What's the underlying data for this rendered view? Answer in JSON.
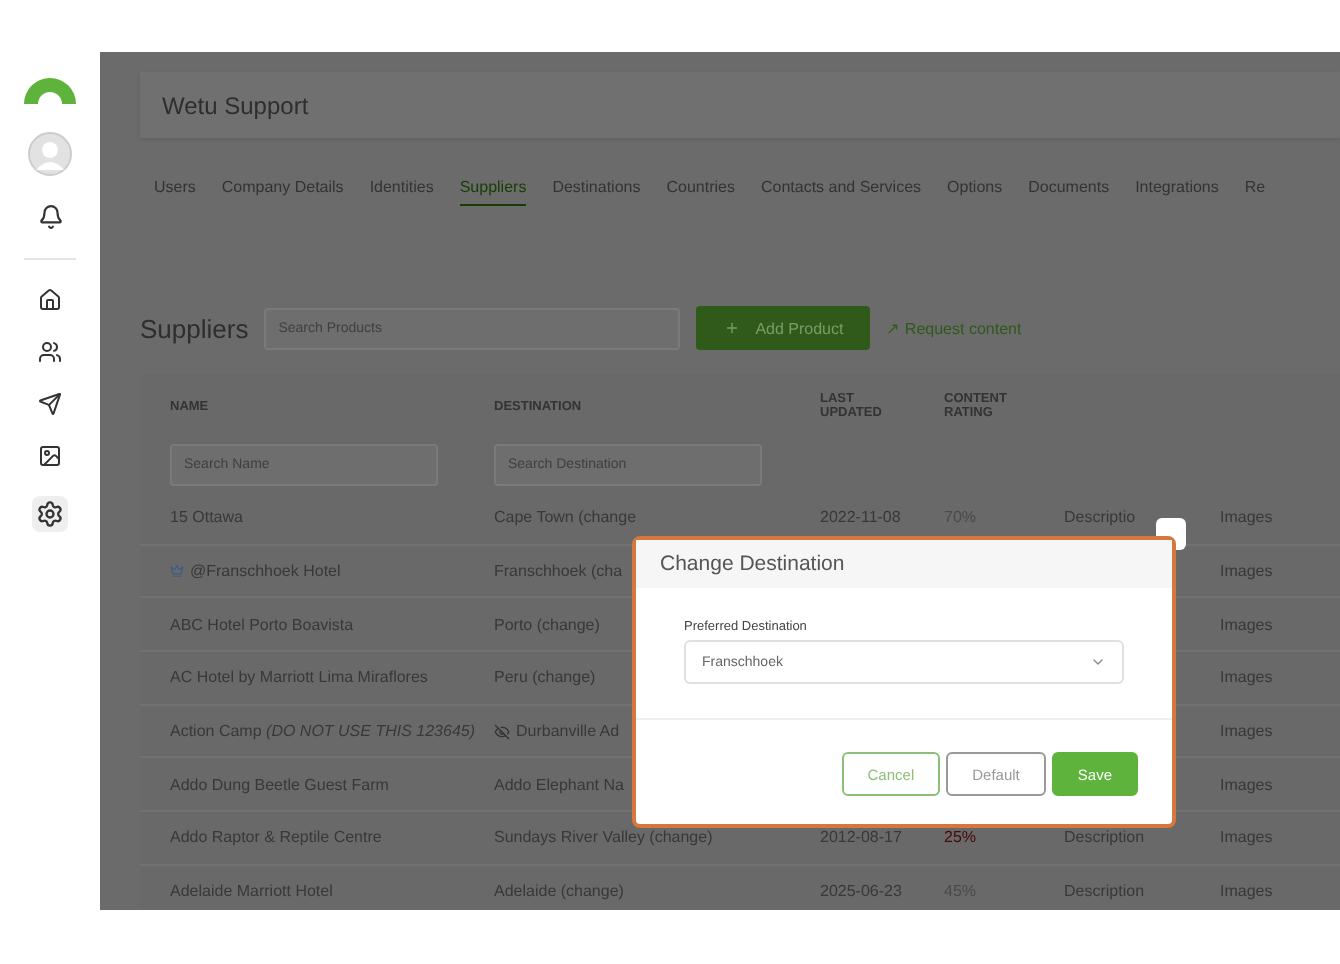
{
  "header": {
    "title": "Wetu Support"
  },
  "tabs": [
    {
      "label": "Users",
      "selected": false
    },
    {
      "label": "Company Details",
      "selected": false
    },
    {
      "label": "Identities",
      "selected": false
    },
    {
      "label": "Suppliers",
      "selected": true
    },
    {
      "label": "Destinations",
      "selected": false
    },
    {
      "label": "Countries",
      "selected": false
    },
    {
      "label": "Contacts and Services",
      "selected": false
    },
    {
      "label": "Options",
      "selected": false
    },
    {
      "label": "Documents",
      "selected": false
    },
    {
      "label": "Integrations",
      "selected": false
    },
    {
      "label": "Re",
      "selected": false
    }
  ],
  "toolbar": {
    "title": "Suppliers",
    "search_placeholder": "Search Products",
    "add_button": "Add Product",
    "link": "↗ Request content"
  },
  "table": {
    "columns": [
      "NAME",
      "DESTINATION",
      "LAST UPDATED",
      "CONTENT RATING"
    ],
    "filters": [
      {
        "placeholder": "Search Name"
      },
      {
        "placeholder": "Search Destination"
      }
    ],
    "rows": [
      {
        "name": "15 Ottawa",
        "destination": "Cape Town (change",
        "updated": "2022-11-08",
        "rating": {
          "text": "70%",
          "color": "#4a4a4a"
        },
        "description": "Descriptio",
        "images": "Images"
      },
      {
        "name": "@Franschhoek Hotel",
        "crown": true,
        "destination": "Franschhoek (cha",
        "images": "Images"
      },
      {
        "name": "ABC Hotel Porto Boavista",
        "destination": "Porto (change)",
        "images": "Images"
      },
      {
        "name": "AC Hotel by Marriott Lima Miraflores",
        "destination": "Peru (change)",
        "images": "Images"
      },
      {
        "name": "Action Camp *(DO NOT USE THIS 123645)*",
        "destination": "Durbanville Ad",
        "hidden": true,
        "images": "Images"
      },
      {
        "name": "Addo Dung Beetle Guest Farm",
        "destination": "Addo Elephant Na",
        "images": "Images"
      },
      {
        "name": "Addo Raptor & Reptile Centre",
        "destination": "Sundays River Valley (change)",
        "updated": "2012-08-17",
        "rating": {
          "text": "25%",
          "color": "#4a0a0a"
        },
        "description": "Description",
        "images": "Images"
      },
      {
        "name": "Adelaide Marriott Hotel",
        "destination": "Adelaide (change)",
        "updated": "2025-06-23",
        "rating": {
          "text": "45%",
          "color": "#4a4a4a"
        },
        "description": "Description",
        "images": "Images"
      }
    ]
  },
  "dialog": {
    "title": "Change Destination",
    "field_label": "Preferred Destination",
    "value": "Franschhoek",
    "buttons": [
      {
        "label": "Cancel",
        "kind": "outline"
      },
      {
        "label": "Default",
        "kind": "plain"
      },
      {
        "label": "Save",
        "kind": "primary"
      }
    ]
  }
}
